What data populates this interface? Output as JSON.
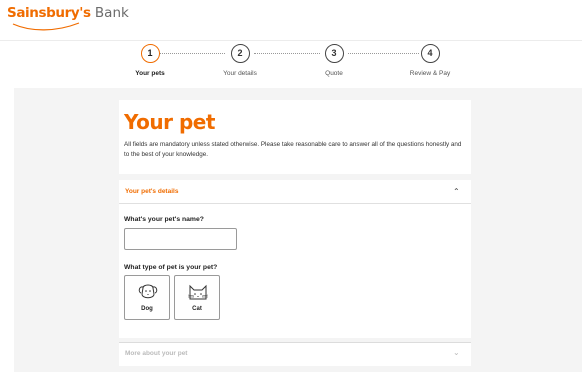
{
  "brand": {
    "name": "Sainsbury's",
    "suffix": "Bank",
    "color": "#f06c00"
  },
  "stepper": {
    "steps": [
      {
        "number": "1",
        "label": "Your pets",
        "active": true
      },
      {
        "number": "2",
        "label": "Your details",
        "active": false
      },
      {
        "number": "3",
        "label": "Quote",
        "active": false
      },
      {
        "number": "4",
        "label": "Review & Pay",
        "active": false
      }
    ]
  },
  "intro": {
    "title": "Your pet",
    "description": "All fields are mandatory unless stated otherwise. Please take reasonable care to answer all of the questions honestly and to the best of your knowledge."
  },
  "details": {
    "section_title": "Your pet's details",
    "expanded_icon": "chevron-up-icon",
    "name_question": "What's your pet's name?",
    "name_value": "",
    "name_placeholder": "",
    "type_question": "What type of pet is your pet?",
    "pet_types": [
      {
        "label": "Dog",
        "icon": "dog-icon"
      },
      {
        "label": "Cat",
        "icon": "cat-icon"
      }
    ]
  },
  "more": {
    "section_title": "More about your pet",
    "collapsed_icon": "chevron-down-icon"
  }
}
